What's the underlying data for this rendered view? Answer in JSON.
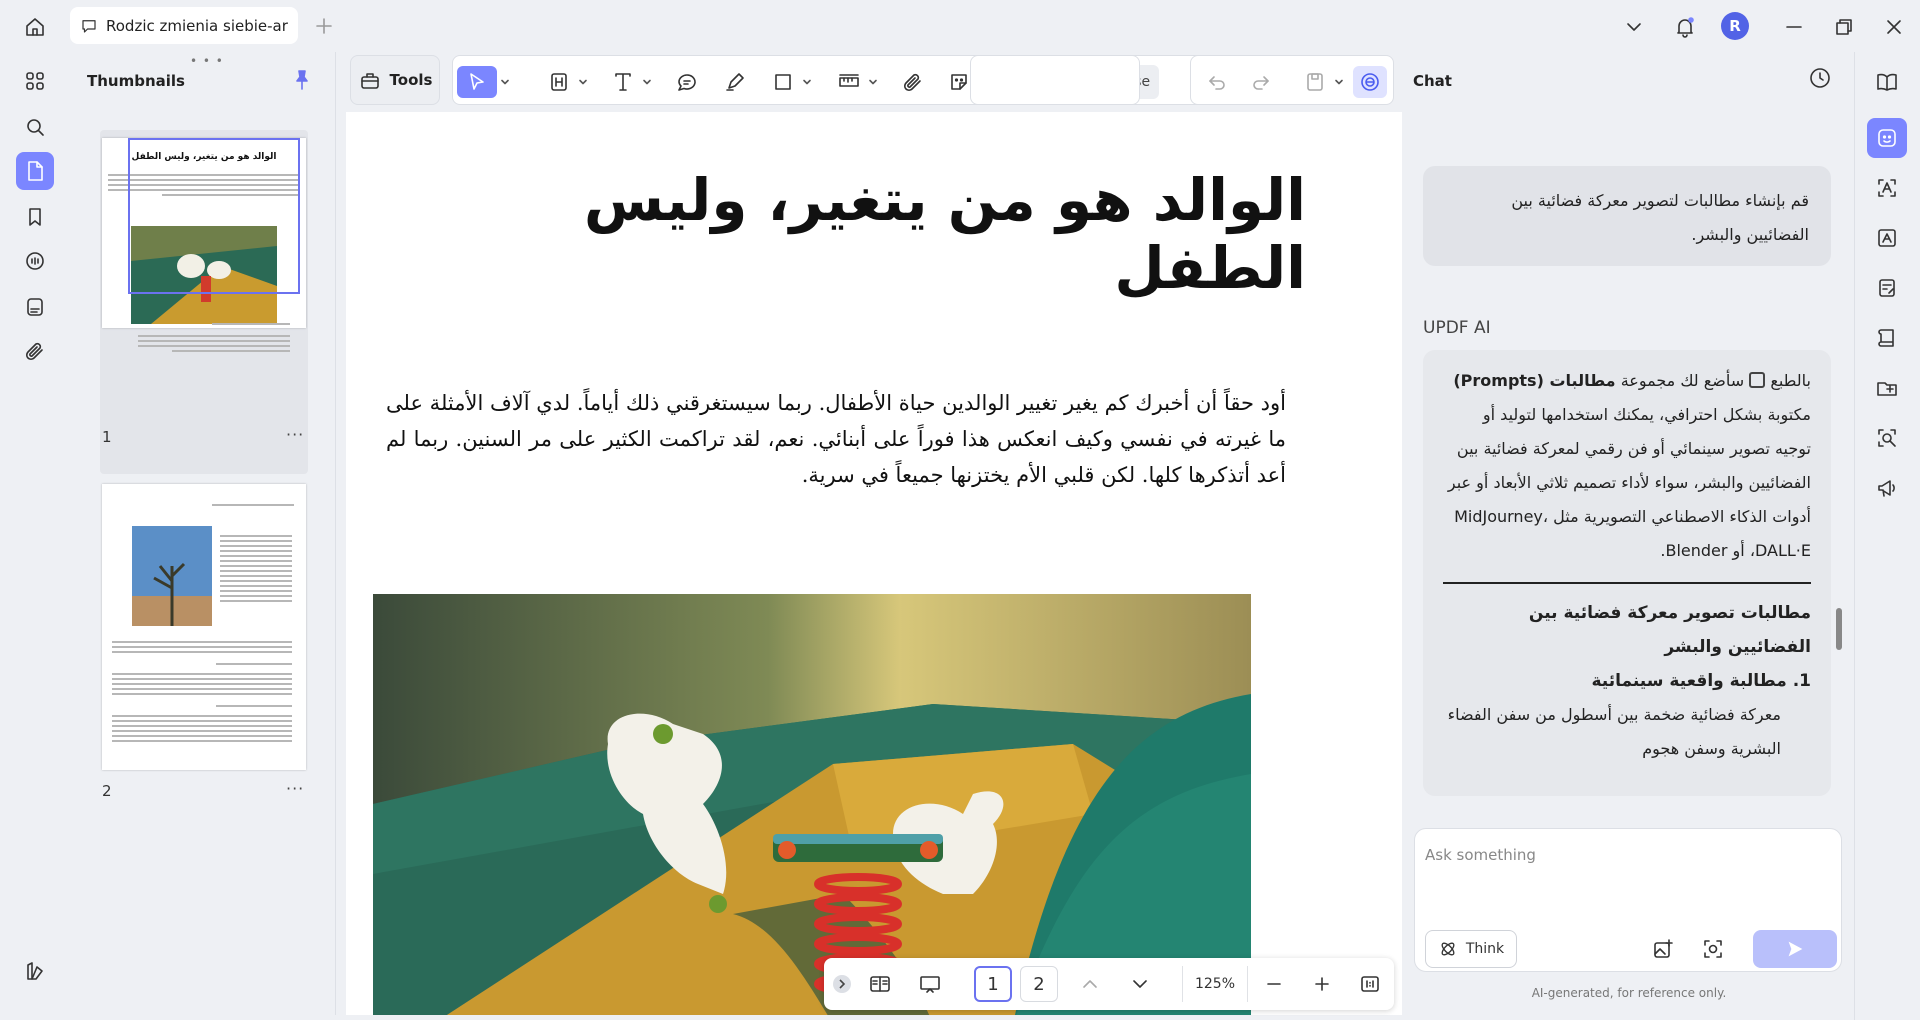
{
  "titlebar": {
    "tab_title": "Rodzic zmienia siebie-ar",
    "avatar_letter": "R"
  },
  "thumbnails": {
    "title": "Thumbnails",
    "page1_number": "1",
    "page2_number": "2",
    "more": "···",
    "page1_heading": "الوالد هو من يتغير، وليس الطفل"
  },
  "toolbar": {
    "tools_label": "Tools",
    "close_label": "Close"
  },
  "document": {
    "title": "الوالد هو من يتغير، وليس الطفل",
    "body": "أود حقاً أن أخبرك كم يغير تغيير الوالدين حياة الأطفال. ربما سيستغرقني ذلك أياماً. لدي آلاف الأمثلة على ما غيرته في نفسي وكيف انعكس هذا فوراً على أبنائي. نعم، لقد تراكمت الكثير على مر السنين. ربما لم أعد أتذكرها كلها. لكن قلبي الأم يختزنها جميعاً في سرية."
  },
  "bottom_nav": {
    "page1": "1",
    "page2": "2",
    "zoom": "125%"
  },
  "chat": {
    "title": "Chat",
    "user_message": "قم بإنشاء مطالبات لتصوير معركة فضائية بين الفضائيين والبشر.",
    "ai_label": "UPDF AI",
    "ai_intro_prefix": "بالطبع",
    "ai_intro_text": "سأضع لك مجموعة",
    "ai_intro_bold": "مطالبات (Prompts)",
    "ai_intro_rest": "مكتوبة بشكل احترافي، يمكنك استخدامها لتوليد أو توجيه تصوير سينمائي أو فن رقمي لمعركة فضائية بين الفضائيين والبشر، سواء لأداء تصميم ثلاثي الأبعاد أو عبر أدوات الذكاء الاصطناعي التصويرية مثل MidJourney، DALL·E، أو Blender.",
    "ai_heading": "مطالبات تصوير معركة فضائية بين الفضائيين والبشر",
    "ai_item1_title": "1. مطالبة واقعية سينمائية",
    "ai_item1_text": "معركة فضائية ضخمة بين أسطول من سفن الفضاء البشرية وسفن هجوم",
    "input_placeholder": "Ask something",
    "think_label": "Think",
    "disclaimer": "AI-generated, for reference only."
  },
  "colors": {
    "accent": "#7b86ff",
    "send_disabled": "#b9c0fb",
    "avatar": "#5263e6"
  }
}
